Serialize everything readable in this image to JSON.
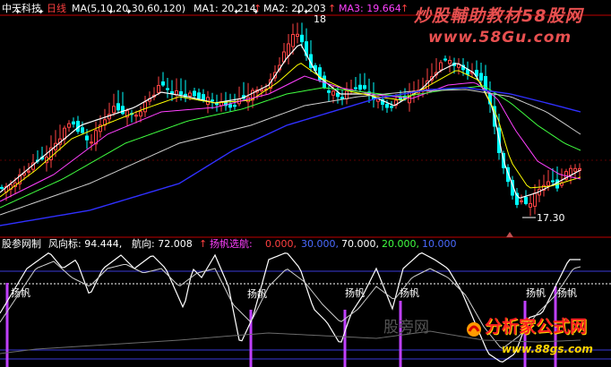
{
  "top_header": {
    "stock_name": "中天科技",
    "period": "日线",
    "ma_spec": "MA(5,10,20,30,60,120)",
    "ma1": "MA1: 20.214",
    "ma1_arrow": "↑",
    "ma2": "MA2: 20.203",
    "ma2_arrow": "↑",
    "ma3": "MA3: 19.664",
    "ma3_arrow": "↑"
  },
  "watermark_top": {
    "text": "炒股輔助教材58股网",
    "url": "www.58Gu.com"
  },
  "price_labels": {
    "high": "18",
    "low": "17.30"
  },
  "indicator_header": {
    "name": "股参网制",
    "wind_label": "风向标: 94.444,",
    "heading_label": "航向: 72.008",
    "heading_arrow": "↑",
    "sail_label": "扬帆选航:",
    "v1": "0.000,",
    "v2": "30.000,",
    "v3": "70.000,",
    "v4": "20.000,",
    "v5": "10.000"
  },
  "signal_labels": [
    "扬帆",
    "扬帆",
    "扬帆",
    "扬帆",
    "扬帆",
    "扬帆"
  ],
  "watermark_bottom": {
    "faint": "股旁网",
    "brand": "分析家公式网",
    "url": "www.88gs.com"
  },
  "colors": {
    "price_up": "#ff4444",
    "price_down": "#00ffff",
    "ma_white": "#ffffff",
    "ma_yellow": "#ffff00",
    "ma_magenta": "#ff40ff",
    "ma_green": "#40ff40",
    "ma_gray": "#cfcfcf",
    "ma_blue": "#3030ff",
    "divider": "#c00000",
    "level_line": "#3a3ad8",
    "signal": "#c040ff",
    "watermark": "#e04a4a"
  }
}
